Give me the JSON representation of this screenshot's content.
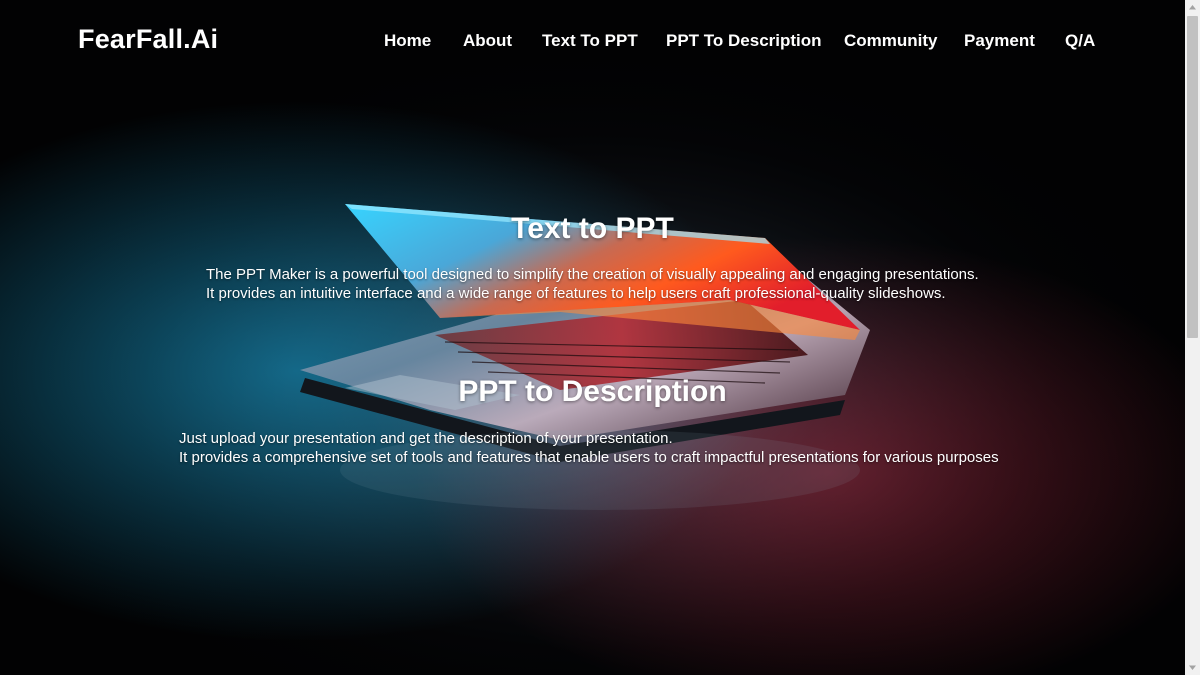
{
  "brand": {
    "name": "FearFall.Ai"
  },
  "nav": {
    "items": [
      {
        "label": "Home"
      },
      {
        "label": "About"
      },
      {
        "label": "Text To PPT"
      },
      {
        "label": "PPT To Description"
      },
      {
        "label": "Community"
      },
      {
        "label": "Payment"
      },
      {
        "label": "Q/A"
      }
    ]
  },
  "sections": [
    {
      "title": "Text to PPT",
      "lines": [
        "The PPT Maker is a powerful tool designed to simplify the creation of visually appealing and engaging presentations.",
        "It provides an intuitive interface and a wide range of features to help users craft professional-quality slideshows."
      ]
    },
    {
      "title": "PPT to Description",
      "lines": [
        "Just upload your presentation and get the description of your presentation.",
        "It provides a comprehensive set of tools and features that enable users to craft impactful presentations for various purposes"
      ]
    }
  ],
  "background": {
    "image": "laptop-illustration",
    "colors": {
      "accent_cyan": "#3fd0ff",
      "accent_orange": "#ff6a2b",
      "accent_red": "#e23a3a",
      "base": "#020203"
    }
  }
}
